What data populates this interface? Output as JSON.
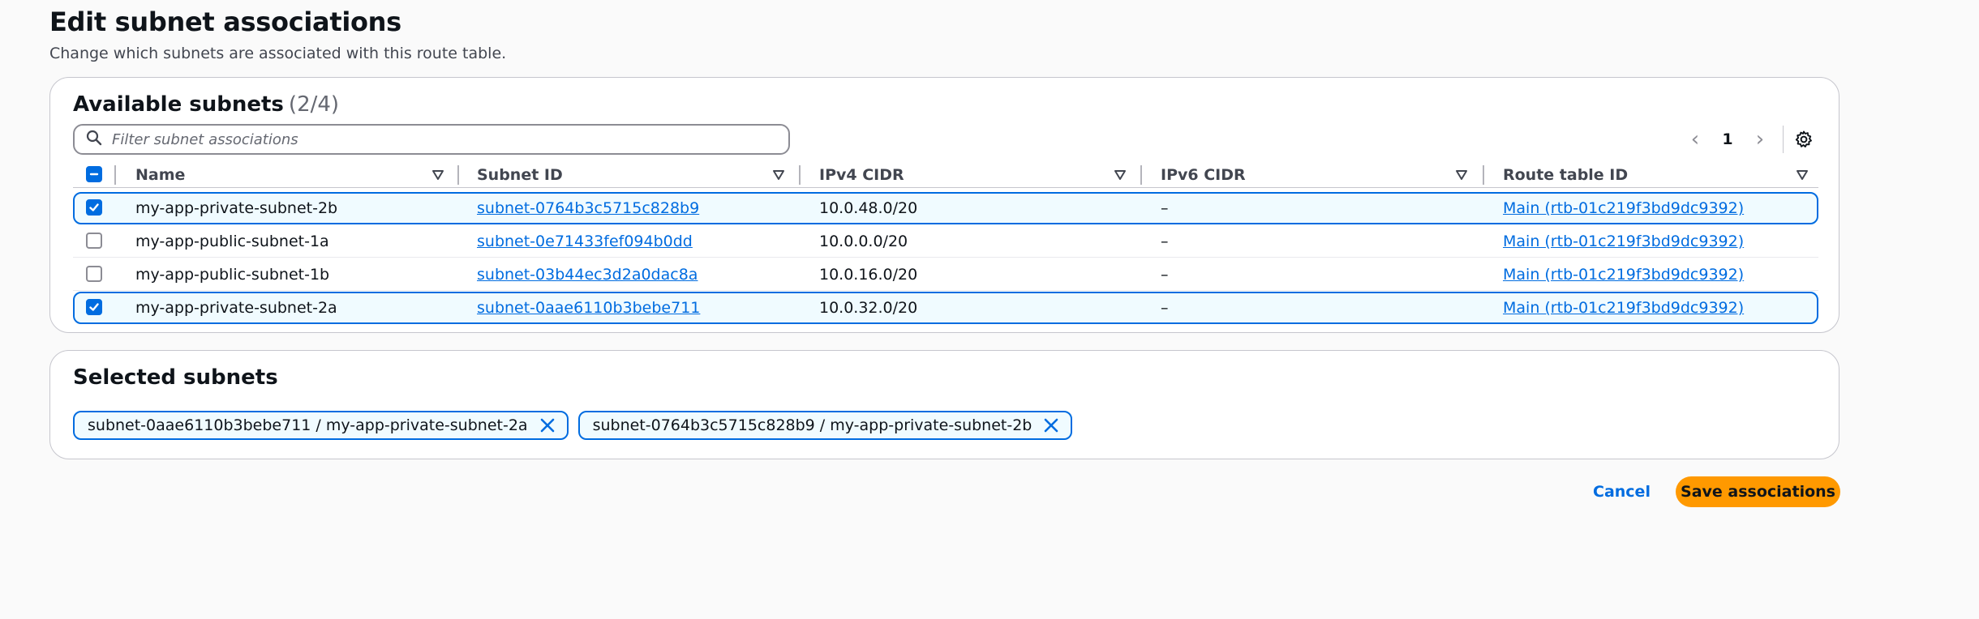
{
  "page": {
    "title": "Edit subnet associations",
    "description": "Change which subnets are associated with this route table."
  },
  "available": {
    "title": "Available subnets",
    "count": "(2/4)",
    "filter_placeholder": "Filter subnet associations",
    "current_page": "1",
    "columns": [
      "Name",
      "Subnet ID",
      "IPv4 CIDR",
      "IPv6 CIDR",
      "Route table ID"
    ],
    "rows": [
      {
        "selected": true,
        "name": "my-app-private-subnet-2b",
        "subnet_id": "subnet-0764b3c5715c828b9",
        "ipv4": "10.0.48.0/20",
        "ipv6": "–",
        "route_table": "Main (rtb-01c219f3bd9dc9392)"
      },
      {
        "selected": false,
        "name": "my-app-public-subnet-1a",
        "subnet_id": "subnet-0e71433fef094b0dd",
        "ipv4": "10.0.0.0/20",
        "ipv6": "–",
        "route_table": "Main (rtb-01c219f3bd9dc9392)"
      },
      {
        "selected": false,
        "name": "my-app-public-subnet-1b",
        "subnet_id": "subnet-03b44ec3d2a0dac8a",
        "ipv4": "10.0.16.0/20",
        "ipv6": "–",
        "route_table": "Main (rtb-01c219f3bd9dc9392)"
      },
      {
        "selected": true,
        "name": "my-app-private-subnet-2a",
        "subnet_id": "subnet-0aae6110b3bebe711",
        "ipv4": "10.0.32.0/20",
        "ipv6": "–",
        "route_table": "Main (rtb-01c219f3bd9dc9392)"
      }
    ]
  },
  "selected": {
    "title": "Selected subnets",
    "tokens": [
      "subnet-0aae6110b3bebe711 / my-app-private-subnet-2a",
      "subnet-0764b3c5715c828b9 / my-app-private-subnet-2b"
    ]
  },
  "actions": {
    "cancel_label": "Cancel",
    "save_label": "Save associations"
  },
  "icons": {
    "search": "search-icon",
    "prev": "chevron-left-icon",
    "next": "chevron-right-icon",
    "settings": "gear-icon",
    "sort": "sort-caret-icon",
    "dismiss": "close-icon"
  },
  "colors": {
    "accent": "#006ce0",
    "primary_button": "#ff9900",
    "selected_row_bg": "#f0fbff"
  }
}
